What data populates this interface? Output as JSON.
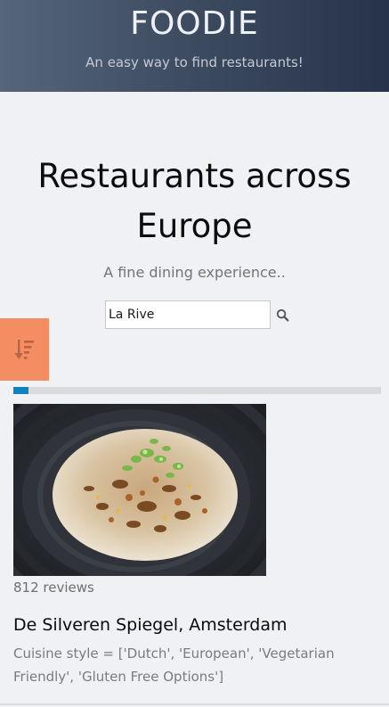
{
  "header": {
    "brand": "FOODIE",
    "tagline": "An easy way to find restaurants!"
  },
  "hero": {
    "title": "Restaurants across Europe",
    "subtitle": "A fine dining experience.."
  },
  "search": {
    "value": "La Rive",
    "icon": "search-icon"
  },
  "sort": {
    "icon": "sort-amount-down-icon",
    "color": "#f48d61"
  },
  "progress": {
    "percent": 4,
    "color": "#0b84c0"
  },
  "restaurant": {
    "image": "fried-rice-dish-photo",
    "reviews": "812 reviews",
    "name": "De Silveren Spiegel, Amsterdam",
    "cuisine": "Cuisine style = ['Dutch', 'European', 'Vegetarian Friendly', 'Gluten Free Options']"
  }
}
